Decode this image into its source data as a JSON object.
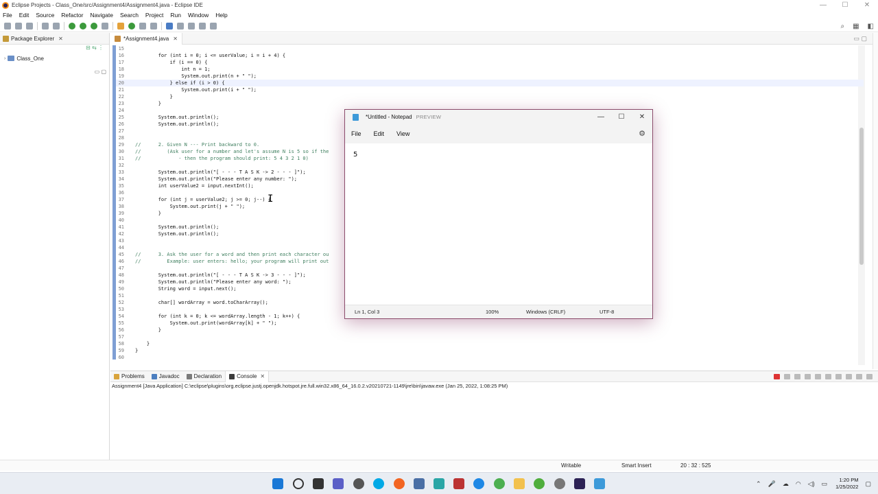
{
  "window": {
    "title": "Eclipse Projects - Class_One/src/Assignment4/Assignment4.java - Eclipse IDE",
    "minimize": "—",
    "maximize": "☐",
    "close": "✕"
  },
  "menu": [
    "File",
    "Edit",
    "Source",
    "Refactor",
    "Navigate",
    "Search",
    "Project",
    "Run",
    "Window",
    "Help"
  ],
  "package_explorer": {
    "title": "Package Explorer",
    "project": "Class_One"
  },
  "editor": {
    "tab_label": "*Assignment4.java",
    "lines": [
      {
        "n": "15",
        "t": ""
      },
      {
        "n": "16",
        "t": "        for (int i = 0; i <= userValue; i = i + 4) {"
      },
      {
        "n": "17",
        "t": "            if (i == 0) {"
      },
      {
        "n": "18",
        "t": "                int n = 1;"
      },
      {
        "n": "19",
        "t": "                System.out.print(n + \" \");"
      },
      {
        "n": "20",
        "t": "            } else if (i > 0) {"
      },
      {
        "n": "21",
        "t": "                System.out.print(i + \" \");"
      },
      {
        "n": "22",
        "t": "            }"
      },
      {
        "n": "23",
        "t": "        }"
      },
      {
        "n": "24",
        "t": ""
      },
      {
        "n": "25",
        "t": "        System.out.println();"
      },
      {
        "n": "26",
        "t": "        System.out.println();"
      },
      {
        "n": "27",
        "t": ""
      },
      {
        "n": "28",
        "t": ""
      },
      {
        "n": "29",
        "t": "//      2. Given N --- Print backward to 0."
      },
      {
        "n": "30",
        "t": "//         (Ask user for a number and let's assume N is 5 so if the"
      },
      {
        "n": "31",
        "t": "//             - then the program should print: 5 4 3 2 1 0)"
      },
      {
        "n": "32",
        "t": ""
      },
      {
        "n": "33",
        "t": "        System.out.println(\"[ - - - T A S K -> 2 - - - ]\");"
      },
      {
        "n": "34",
        "t": "        System.out.println(\"Please enter any number: \");"
      },
      {
        "n": "35",
        "t": "        int userValue2 = input.nextInt();"
      },
      {
        "n": "36",
        "t": ""
      },
      {
        "n": "37",
        "t": "        for (int j = userValue2; j >= 0; j--) {"
      },
      {
        "n": "38",
        "t": "            System.out.print(j + \" \");"
      },
      {
        "n": "39",
        "t": "        }"
      },
      {
        "n": "40",
        "t": ""
      },
      {
        "n": "41",
        "t": "        System.out.println();"
      },
      {
        "n": "42",
        "t": "        System.out.println();"
      },
      {
        "n": "43",
        "t": ""
      },
      {
        "n": "44",
        "t": ""
      },
      {
        "n": "45",
        "t": "//      3. Ask the user for a word and then print each character ou"
      },
      {
        "n": "46",
        "t": "//         Example: user enters: hello; your program will print out"
      },
      {
        "n": "47",
        "t": ""
      },
      {
        "n": "48",
        "t": "        System.out.println(\"[ - - - T A S K -> 3 - - - ]\");"
      },
      {
        "n": "49",
        "t": "        System.out.println(\"Please enter any word: \");"
      },
      {
        "n": "50",
        "t": "        String word = input.next();"
      },
      {
        "n": "51",
        "t": ""
      },
      {
        "n": "52",
        "t": "        char[] wordArray = word.toCharArray();"
      },
      {
        "n": "53",
        "t": ""
      },
      {
        "n": "54",
        "t": "        for (int k = 0; k <= wordArray.length - 1; k++) {"
      },
      {
        "n": "55",
        "t": "            System.out.print(wordArray[k] + \" \");"
      },
      {
        "n": "56",
        "t": "        }"
      },
      {
        "n": "57",
        "t": ""
      },
      {
        "n": "58",
        "t": "    }"
      },
      {
        "n": "59",
        "t": "}"
      },
      {
        "n": "60",
        "t": ""
      }
    ]
  },
  "bottom_panel": {
    "tabs": [
      "Problems",
      "Javadoc",
      "Declaration",
      "Console"
    ],
    "console_header": "Assignment4 [Java Application] C:\\eclipse\\plugins\\org.eclipse.justj.openjdk.hotspot.jre.full.win32.x86_64_16.0.2.v20210721-1149\\jre\\bin\\javaw.exe  (Jan 25, 2022, 1:08:25 PM)"
  },
  "statusbar": {
    "writable": "Writable",
    "insert_mode": "Smart Insert",
    "position": "20 : 32 : 525"
  },
  "notepad": {
    "title": "*Untitled - Notepad",
    "preview": "PREVIEW",
    "menu": [
      "File",
      "Edit",
      "View"
    ],
    "content": "5",
    "status": {
      "position": "Ln 1, Col 3",
      "zoom": "100%",
      "line_ending": "Windows (CRLF)",
      "encoding": "UTF-8"
    }
  },
  "taskbar": {
    "time": "1:20 PM",
    "date": "1/25/2022"
  },
  "colors": {
    "comment": "#3f7f5f",
    "string": "#2a00ff",
    "keyword": "#7f0055",
    "notepad_border": "#8a4a6a"
  }
}
